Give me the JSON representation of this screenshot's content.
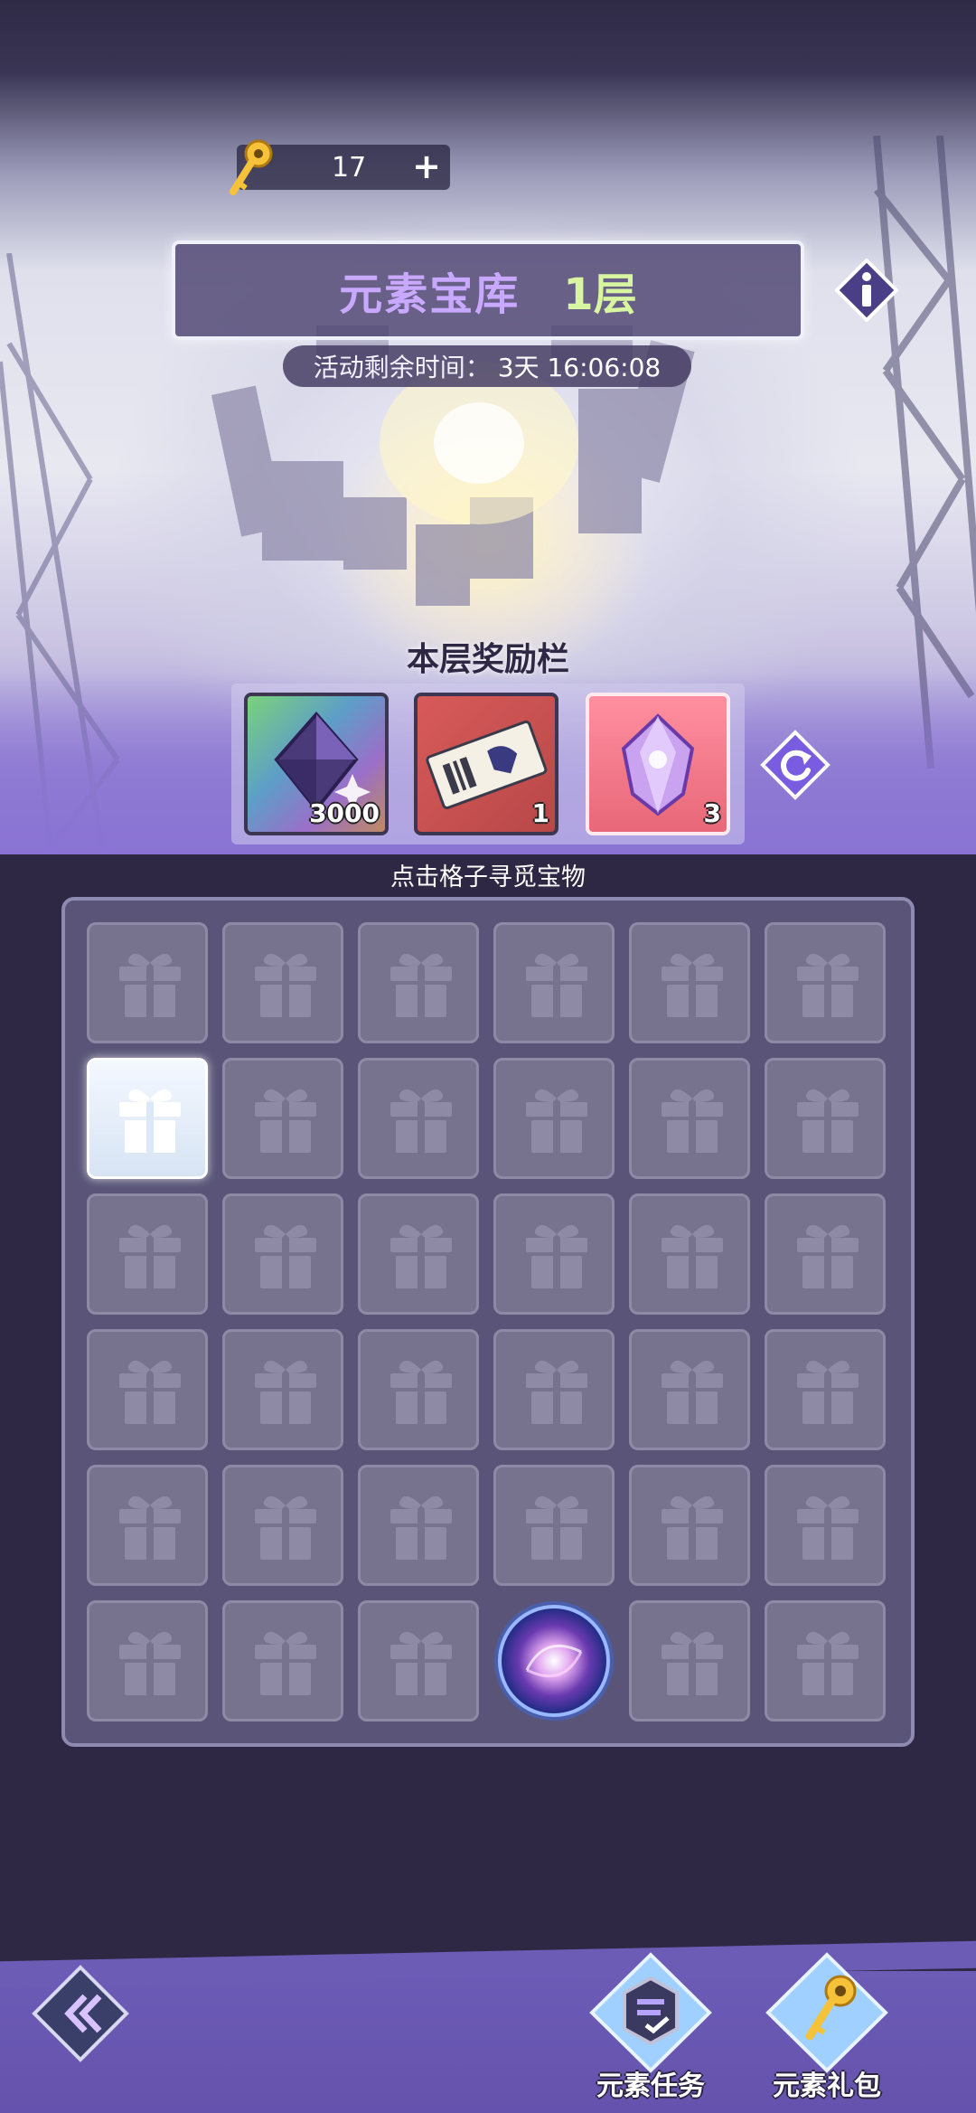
{
  "header": {
    "key_count": "17",
    "add_label": "+",
    "title_name": "元素宝库",
    "title_floor": "1层",
    "timer_label": "活动剩余时间：",
    "timer_value": "3天 16:06:08"
  },
  "rewards": {
    "title": "本层奖励栏",
    "items": [
      {
        "icon": "purple-diamond-icon",
        "qty": "3000"
      },
      {
        "icon": "ticket-icon",
        "qty": "1"
      },
      {
        "icon": "element-crystal-icon",
        "qty": "3"
      }
    ]
  },
  "board": {
    "hint": "点击格子寻觅宝物",
    "rows": 6,
    "cols": 6,
    "opened_cells": [
      [
        1,
        0
      ]
    ],
    "portal_cell": [
      5,
      3
    ]
  },
  "footer": {
    "task_label": "元素任务",
    "gift_label": "元素礼包"
  },
  "colors": {
    "title_name": "#c9a9ff",
    "title_floor": "#d8f6a0",
    "panel": "#5a5578",
    "cell": "#77738f",
    "bottom_bar": "#6c5cb6"
  }
}
